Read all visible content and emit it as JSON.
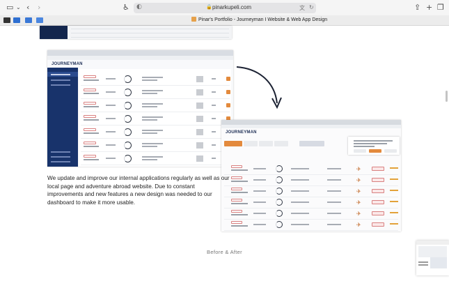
{
  "browser": {
    "url": "pinarkupeli.com",
    "active_tab_title": "Pinar's Portfolio - Journeyman I Website & Web App Design",
    "icons": [
      "sidebar-icon",
      "chevron-down-icon",
      "back-icon",
      "forward-icon",
      "accessibility-icon",
      "shield-icon",
      "lock-icon",
      "translate-icon",
      "reload-icon",
      "share-icon",
      "new-tab-icon",
      "tabs-overview-icon"
    ]
  },
  "content": {
    "before_brand": "JOURNEYMAN",
    "after_brand": "JOURNEYMAN",
    "description": "We update and improve our internal applications regularly as well as our local page and adventure abroad website. Due to constant improvements and new features a new design was needed to our dashboard to make it more usable.",
    "caption": "Before & After"
  },
  "colors": {
    "sidebar_navy": "#18336b",
    "accent_orange": "#e38a3d",
    "tag_red": "#d98080"
  }
}
